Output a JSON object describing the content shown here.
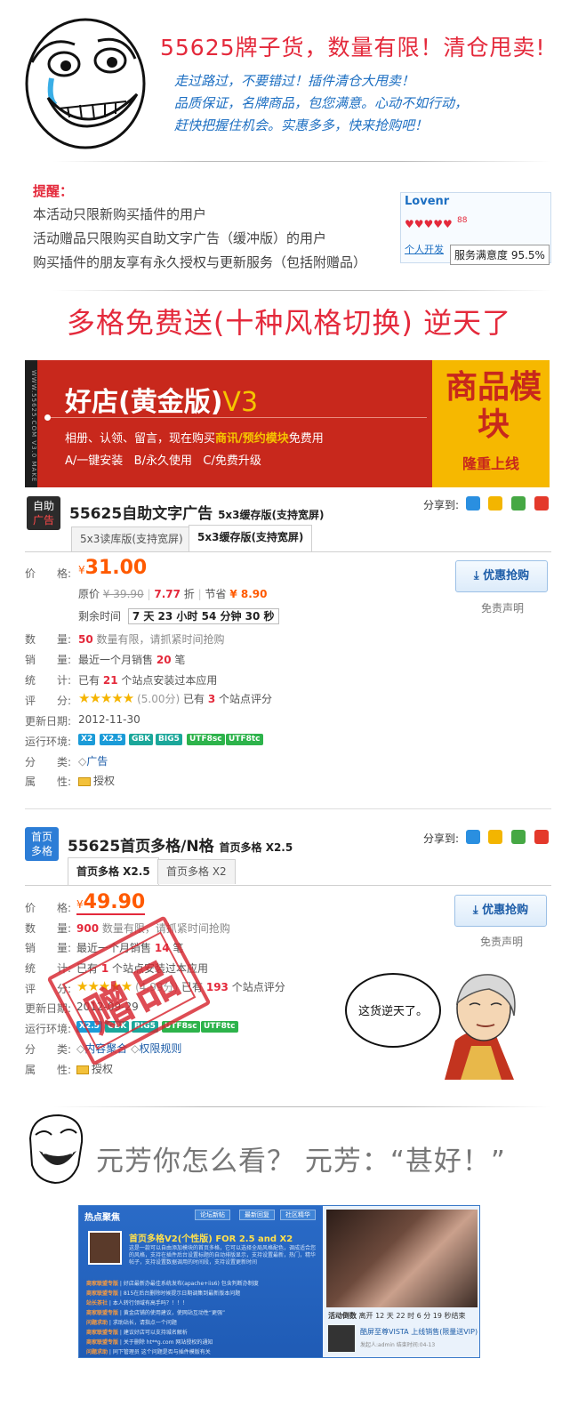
{
  "header": {
    "title": "55625牌子货，数量有限！清仓甩卖!",
    "lines": [
      "走过路过，不要错过！插件清仓大甩卖！",
      "品质保证，名牌商品，包您满意。心动不如行动，",
      "赶快把握住机会。实惠多多，快来抢购吧！"
    ]
  },
  "notice": {
    "title": "提醒：",
    "lines": [
      "本活动只限新购买插件的用户",
      "活动赠品只限购买自助文字广告（缓冲版）的用户",
      "购买插件的朋友享有永久授权与更新服务（包括附赠品）"
    ]
  },
  "shop": {
    "name": "Lovenr",
    "hearts": "♥♥♥♥♥",
    "heart_count": "88",
    "personal": "个人开发",
    "satisfaction": "服务满意度 95.5%"
  },
  "slogan": "多格免费送(十种风格切换) 逆天了",
  "banner": {
    "side_text": "WWW.55625.COM V3.0 MAKE",
    "title_main": "好店(黄金版)",
    "title_version": "V3",
    "desc_prefix": "相册、认领、留言，现在购买",
    "desc_highlight": "商讯/预约模块",
    "desc_suffix": "免费用",
    "options": "A/一键安装   B/永久使用   C/免费升级",
    "right_main": "商品模块",
    "right_sub": "隆重上线"
  },
  "colors": {
    "accent_red": "#e4293b",
    "price_orange": "#ff5a00",
    "link_blue": "#1d5da8"
  },
  "product1": {
    "icon_top": "自助",
    "icon_bottom": "广告",
    "title": "55625自助文字广告",
    "subtitle": "5x3缓存版(支持宽屏)",
    "share_label": "分享到:",
    "tabs": [
      "5x3读库版(支持宽屏)",
      "5x3缓存版(支持宽屏)"
    ],
    "price_label": "价　　格:",
    "currency": "¥",
    "price": "31.00",
    "orig_label": "原价",
    "orig_price": "¥ 39.90",
    "discount": "7.77",
    "discount_unit": "折",
    "save_label": "节省",
    "save_amount": "¥ 8.90",
    "remain_label": "剩余时间",
    "remain": "7 天 23 小时 54 分钟 30 秒",
    "buy": "优惠抢购",
    "disclaimer": "免责声明",
    "qty_label": "数　　量:",
    "qty": "50",
    "qty_note": "数量有限，请抓紧时间抢购",
    "sales_label": "销　　量:",
    "sales_pre": "最近一个月销售",
    "sales": "20",
    "sales_post": "笔",
    "stats_label": "统　　计:",
    "stats_pre": "已有",
    "stats": "21",
    "stats_post": "个站点安装过本应用",
    "rating_label": "评　　分:",
    "stars": "★★★★★",
    "rating": "(5.00分)",
    "rating_pre": "已有",
    "rating_count": "3",
    "rating_post": "个站点评分",
    "updated_label": "更新日期:",
    "updated": "2012-11-30",
    "env_label": "运行环境:",
    "env": [
      "X2",
      "X2.5",
      "GBK",
      "BIG5",
      "UTF8sc",
      "UTF8tc"
    ],
    "category_label": "分　　类:",
    "category": "广告",
    "attr_label": "属　　性:",
    "attr": "授权"
  },
  "product2": {
    "icon_top": "首页",
    "icon_bottom": "多格",
    "title": "55625首页多格/N格",
    "subtitle": "首页多格 X2.5",
    "share_label": "分享到:",
    "tabs": [
      "首页多格 X2.5",
      "首页多格 X2"
    ],
    "price_label": "价　　格:",
    "currency": "¥",
    "price": "49.90",
    "buy": "优惠抢购",
    "disclaimer": "免责声明",
    "qty_label": "数　　量:",
    "qty": "900",
    "qty_note": "数量有限，请抓紧时间抢购",
    "sales_label": "销　　量:",
    "sales_pre": "最近一个月销售",
    "sales": "14",
    "sales_post": "笔",
    "stats_label": "统　　计:",
    "stats_pre": "已有",
    "stats": "1",
    "stats_post": "个站点安装过本应用",
    "rating_label": "评　　分:",
    "stars": "★★★★★",
    "rating": "(4.99分)",
    "rating_pre": "已有",
    "rating_count": "193",
    "rating_post": "个站点评分",
    "updated_label": "更新日期:",
    "updated": "2012-09-29",
    "env_label": "运行环境:",
    "env": [
      "X2.5",
      "GBK",
      "BIG5",
      "UTF8sc",
      "UTF8tc"
    ],
    "category_label": "分　　类:",
    "categories": [
      "内容聚合",
      "权限规则"
    ],
    "attr_label": "属　　性:",
    "attr": "授权",
    "stamp": "赠品"
  },
  "bubble": "这货逆天了。",
  "yuanfang": "元芳你怎么看？ 元芳：“甚好！”",
  "preview": {
    "head": "热点聚焦",
    "buttons": [
      "论坛新帖",
      "最新回复",
      "社区精华"
    ],
    "feature_title": "首页多格V2(个性版) FOR 2.5 and X2",
    "feature_desc": "这是一款可以自由添加模块的首页多格，它可以选择全局风格配色，调成适合您的风格，支持在插件后台设置标题的自动排版显示，支持设置最新，热门，精华帖子，支持设置数据调用的时间段，支持设置更新时间",
    "items": [
      {
        "tag": "商家联盟专版",
        "text": "好店最新办最佳系统发布(apache+iis6) 包含判断办制度"
      },
      {
        "tag": "商家联盟专版",
        "text": "815在后台删除时候提示日期调集到最新版本问题"
      },
      {
        "tag": "站长茶社",
        "text": "本人转行领域有高手吗？！！！"
      },
      {
        "tag": "商家联盟专版",
        "text": "黄金店铺的使用建议，使网站互动性“更强”"
      },
      {
        "tag": "问题求助",
        "text": "求助站长，请指点一个问题"
      },
      {
        "tag": "商家联盟专版",
        "text": "建议好店可以支持城名解析"
      },
      {
        "tag": "商家联盟专版",
        "text": "关于删除 ht**g.com 网站授权的通知"
      },
      {
        "tag": "问题求助",
        "text": "同下管理员 这个问题是否与插件模版有关"
      }
    ],
    "countdown_label": "活动倒数",
    "countdown": "离开 12 天 22 时 6 分 19 秒结束",
    "mini_title": "酷屏至尊VISTA 上线销售(限量送VIP)",
    "mini_meta": "发起人:admin 结束时间:04-13"
  }
}
